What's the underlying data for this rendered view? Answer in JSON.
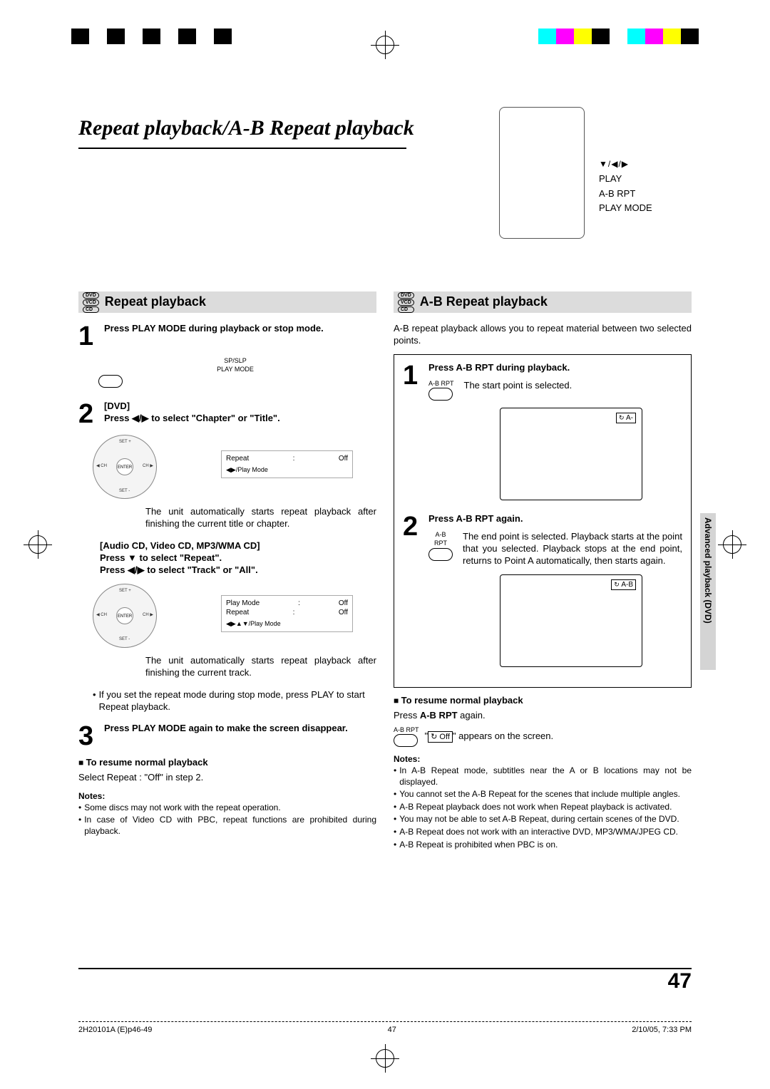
{
  "page_title": "Repeat playback/A-B Repeat playback",
  "remote_labels": {
    "line2": "PLAY",
    "line3": "A-B RPT",
    "line4": "PLAY MODE"
  },
  "left": {
    "section_title": "Repeat playback",
    "disc_types": [
      "DVD",
      "VCD",
      "CD"
    ],
    "step1": "Press PLAY MODE during playback or stop mode.",
    "btn1_top": "SP/SLP",
    "btn1_bot": "PLAY MODE",
    "step2a": "[DVD]",
    "step2b": "Press ◀/▶ to select \"Chapter\" or \"Title\".",
    "nav_center": "ENTER",
    "osd1_l1a": "Repeat",
    "osd1_l1b": ":",
    "osd1_l1c": "Off",
    "osd1_l2": "◀▶/Play Mode",
    "para1": "The unit automatically starts repeat playback after finishing the current title or chapter.",
    "step2c": "[Audio CD, Video CD, MP3/WMA CD]",
    "step2d": "Press ▼ to select \"Repeat\".",
    "step2e": "Press ◀/▶ to select \"Track\" or \"All\".",
    "osd2_l1a": "Play Mode",
    "osd2_l1b": ":",
    "osd2_l1c": "Off",
    "osd2_l2a": "Repeat",
    "osd2_l2b": ":",
    "osd2_l2c": "Off",
    "osd2_l3": "◀▶▲▼/Play Mode",
    "para2": "The unit automatically starts repeat playback after finishing the current track.",
    "tip1": "If you set the repeat mode during stop mode, press PLAY to start Repeat playback.",
    "step3": "Press PLAY MODE again to make the screen disappear.",
    "resume_head": "To resume normal playback",
    "resume_body": "Select Repeat : \"Off\" in step 2.",
    "notes_head": "Notes:",
    "note1": "Some discs may not work with the repeat operation.",
    "note2": "In case of Video CD with PBC, repeat functions are prohibited during playback."
  },
  "right": {
    "section_title": "A-B Repeat playback",
    "disc_types": [
      "DVD",
      "VCD",
      "CD"
    ],
    "intro": "A-B repeat playback allows you to repeat material between two selected points.",
    "step1": "Press A-B RPT during playback.",
    "btn1_cap": "A-B RPT",
    "step1_text": "The start point is selected.",
    "tv1_corner": "A-",
    "step2": "Press A-B RPT again.",
    "btn2_cap": "A-B RPT",
    "step2_text": "The end point is selected. Playback starts at the point that you selected. Playback stops at the end point, returns to Point A automatically, then starts again.",
    "tv2_corner": "A-B",
    "resume_head": "To resume normal playback",
    "resume_body_pre": "Press ",
    "resume_body_bold": "A-B RPT",
    "resume_body_post": " again.",
    "btn3_cap": "A-B RPT",
    "off_label": "Off",
    "off_after": " appears on the screen.",
    "notes_head": "Notes:",
    "n1": "In A-B Repeat mode, subtitles near the A or B locations may not be displayed.",
    "n2": "You cannot set the A-B Repeat for the scenes that include multiple angles.",
    "n3": "A-B Repeat playback does not work when Repeat playback is activated.",
    "n4": "You may not be able to set A-B Repeat, during certain scenes of the DVD.",
    "n5": "A-B Repeat does not work with an interactive DVD, MP3/WMA/JPEG CD.",
    "n6": "A-B Repeat is prohibited when PBC is on."
  },
  "side_tab": "Advanced playback (DVD)",
  "page_number": "47",
  "footer": {
    "left": "2H20101A (E)p46-49",
    "center": "47",
    "right": "2/10/05, 7:33 PM"
  }
}
